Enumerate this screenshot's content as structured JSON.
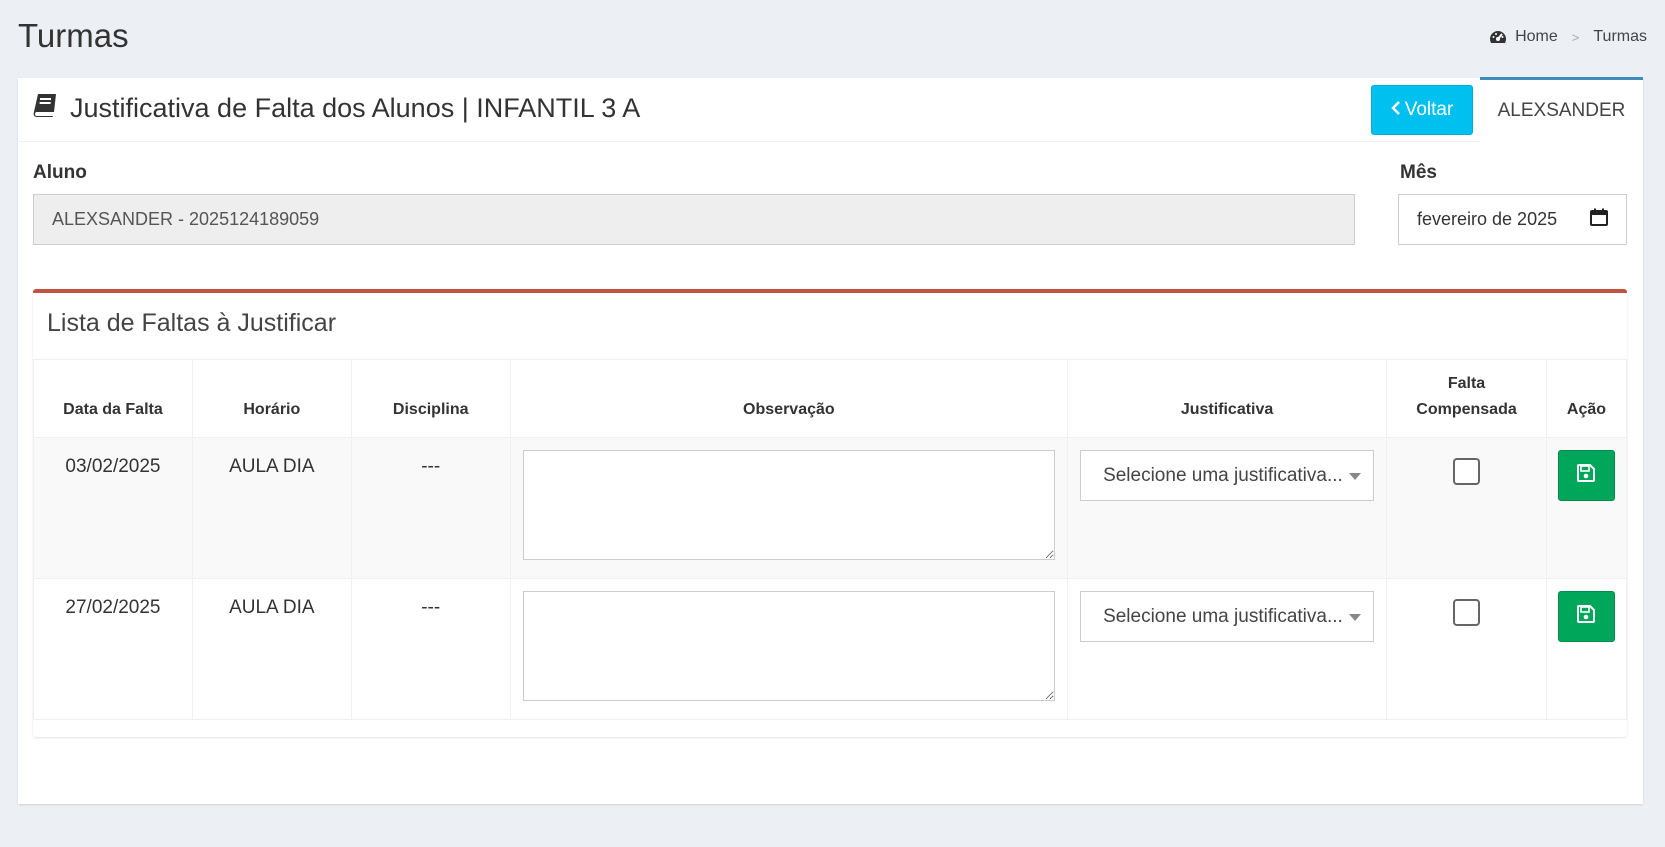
{
  "header": {
    "title": "Turmas",
    "breadcrumb": {
      "home": "Home",
      "separator": ">",
      "current": "Turmas"
    }
  },
  "box": {
    "title": "Justificativa de Falta dos Alunos | INFANTIL 3 A",
    "back_button": "Voltar",
    "user_tab": "ALEXSANDER"
  },
  "form": {
    "aluno_label": "Aluno",
    "aluno_value": "ALEXSANDER - 2025124189059",
    "mes_label": "Mês",
    "mes_value": "fevereiro de 2025"
  },
  "faltas": {
    "title": "Lista de Faltas à Justificar",
    "columns": {
      "data": "Data da Falta",
      "horario": "Horário",
      "disciplina": "Disciplina",
      "observacao": "Observação",
      "justificativa": "Justificativa",
      "falta_line1": "Falta",
      "falta_line2": "Compensada",
      "acao": "Ação"
    },
    "rows": [
      {
        "data": "03/02/2025",
        "horario": "AULA DIA",
        "disciplina": "---",
        "observacao": "",
        "justificativa": "Selecione uma justificativa...",
        "compensada": false
      },
      {
        "data": "27/02/2025",
        "horario": "AULA DIA",
        "disciplina": "---",
        "observacao": "",
        "justificativa": "Selecione uma justificativa...",
        "compensada": false
      }
    ]
  },
  "icons": {
    "breadcrumb": "dashboard-icon",
    "title": "book-icon",
    "back": "chevron-left-icon",
    "calendar": "calendar-icon",
    "save": "floppy-disk-icon"
  },
  "colors": {
    "accent": "#00c0ef",
    "tab_border": "#3c8dbc",
    "box_border": "#c0533f",
    "save": "#00a65a"
  }
}
